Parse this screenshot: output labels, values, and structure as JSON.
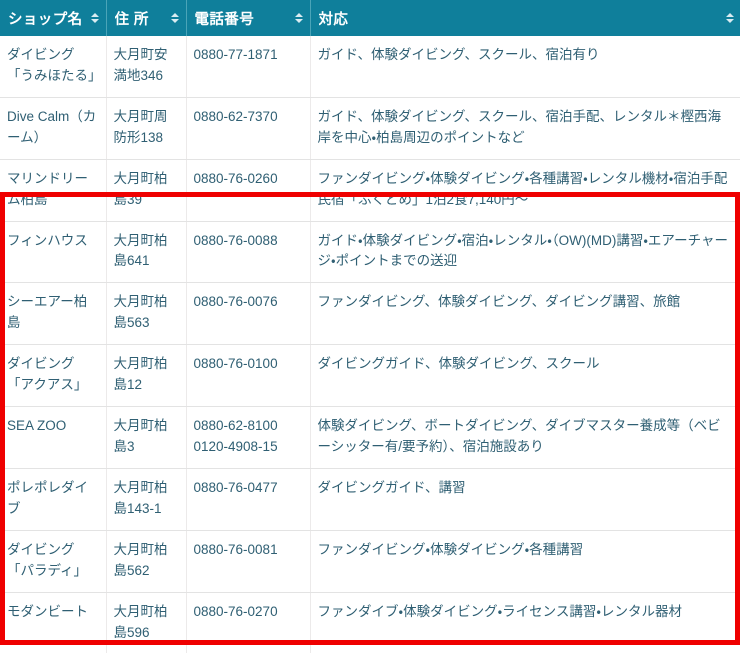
{
  "table": {
    "columns": [
      {
        "label": "ショップ名",
        "sortable": true,
        "sort_icon": "sort-updown-icon"
      },
      {
        "label": "住 所",
        "sortable": true,
        "sort_icon": "sort-updown-icon"
      },
      {
        "label": "電話番号",
        "sortable": true,
        "sort_icon": "sort-updown-icon"
      },
      {
        "label": "対応",
        "sortable": true,
        "sort_icon": "sort-updown-icon"
      }
    ],
    "rows": [
      {
        "name": "ダイビング「うみほたる」",
        "address": "大月町安満地346",
        "tel": [
          "0880-77-1871"
        ],
        "desc": "ガイド、体験ダイビング、スクール、宿泊有り",
        "highlighted": false
      },
      {
        "name": "Dive Calm（カーム）",
        "address": "大月町周防形138",
        "tel": [
          "0880-62-7370"
        ],
        "desc": "ガイド、体験ダイビング、スクール、宿泊手配、レンタル＊樫西海岸を中心・柏島周辺のポイントなど",
        "highlighted": false
      },
      {
        "name": "マリンドリーム柏島",
        "address": "大月町柏島39",
        "tel": [
          "0880-76-0260"
        ],
        "desc": "ファンダイビング・体験ダイビング・各種講習・レンタル機材・宿泊手配 民宿「ふくどめ」1泊2食7,140円〜",
        "highlighted": true
      },
      {
        "name": "フィンハウス",
        "address": "大月町柏島641",
        "tel": [
          "0880-76-0088"
        ],
        "desc": "ガイド・体験ダイビング・宿泊・レンタル・（OW)(MD)講習・エアーチャージ・ポイントまでの送迎",
        "highlighted": true
      },
      {
        "name": "シーエアー柏島",
        "address": "大月町柏島563",
        "tel": [
          "0880-76-0076"
        ],
        "desc": "ファンダイビング、体験ダイビング、ダイビング講習、旅館",
        "highlighted": true
      },
      {
        "name": "ダイビング「アクアス」",
        "address": "大月町柏島12",
        "tel": [
          "0880-76-0100"
        ],
        "desc": "ダイビングガイド、体験ダイビング、スクール",
        "highlighted": true
      },
      {
        "name": "SEA ZOO",
        "address": "大月町柏島3",
        "tel": [
          "0880-62-8100",
          "0120-4908-15"
        ],
        "desc": "体験ダイビング、ボートダイビング、ダイブマスター養成等（ベビーシッター有/要予約）、宿泊施設あり",
        "highlighted": true
      },
      {
        "name": "ポレポレダイブ",
        "address": "大月町柏島143-1",
        "tel": [
          "0880-76-0477"
        ],
        "desc": "ダイビングガイド、講習",
        "highlighted": true
      },
      {
        "name": "ダイビング「パラディ」",
        "address": "大月町柏島562",
        "tel": [
          "0880-76-0081"
        ],
        "desc": "ファンダイビング・体験ダイビング・各種講習",
        "highlighted": true
      },
      {
        "name": "モダンビート",
        "address": "大月町柏島596",
        "tel": [
          "0880-76-0270"
        ],
        "desc": "ファンダイブ・体験ダイビング・ライセンス講習・レンタル器材",
        "highlighted": true
      }
    ]
  },
  "colors": {
    "header_background": "#0f7f9b",
    "header_text": "#ffffff",
    "body_text": "#2f5f73",
    "row_border": "#e3e3e3",
    "highlight_border": "#ef0000"
  }
}
